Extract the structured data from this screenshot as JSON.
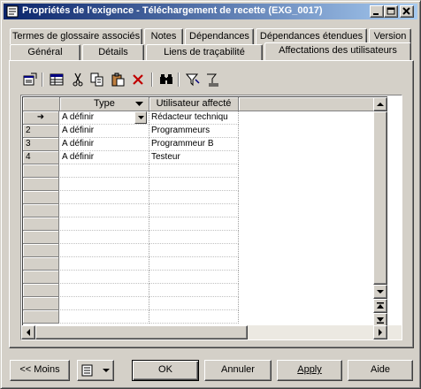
{
  "window": {
    "title": "Propriétés de l'exigence - Téléchargement de recette (EXG_0017)",
    "minimize": "_",
    "maximize": "□",
    "close": "×"
  },
  "tabs": {
    "row_back": [
      "Termes de glossaire associés",
      "Notes",
      "Dépendances",
      "Dépendances étendues",
      "Version"
    ],
    "row_front": [
      "Général",
      "Détails",
      "Liens de traçabilité",
      "Affectations des utilisateurs"
    ],
    "active": "Affectations des utilisateurs"
  },
  "toolbar": {
    "icons": [
      "properties-icon",
      "add-rows-icon",
      "cut-icon",
      "copy-icon",
      "paste-icon",
      "delete-icon",
      "find-icon",
      "filter-icon",
      "clear-filter-icon"
    ]
  },
  "grid": {
    "columns": [
      "Type",
      "Utilisateur affecté"
    ],
    "rows": [
      {
        "num": "",
        "current": true,
        "type": "A définir",
        "user": "Rédacteur techniqu"
      },
      {
        "num": "2",
        "current": false,
        "type": "A définir",
        "user": "Programmeurs"
      },
      {
        "num": "3",
        "current": false,
        "type": "A définir",
        "user": "Programmeur B"
      },
      {
        "num": "4",
        "current": false,
        "type": "A définir",
        "user": "Testeur"
      }
    ],
    "current_row_marker": "➜"
  },
  "buttons": {
    "less": "<< Moins",
    "ok": "OK",
    "cancel": "Annuler",
    "apply": "Apply",
    "help": "Aide"
  },
  "colors": {
    "face": "#d4d0c8",
    "title_start": "#0a246a",
    "title_end": "#a6caf0"
  }
}
